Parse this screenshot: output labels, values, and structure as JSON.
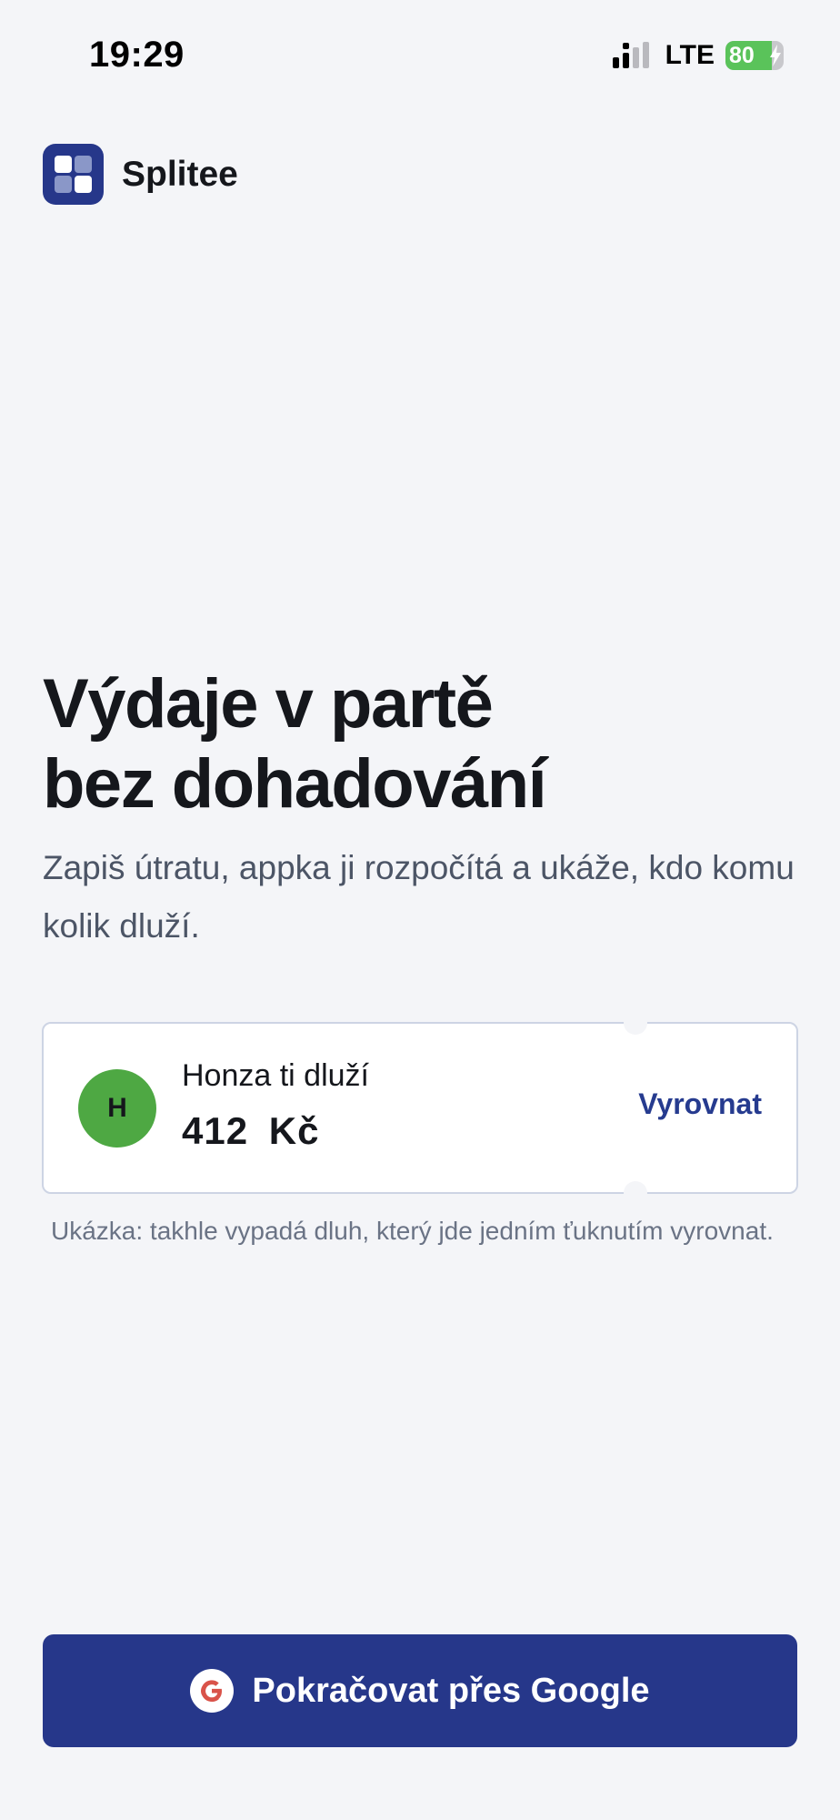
{
  "status_bar": {
    "time": "19:29",
    "network": "LTE",
    "battery": "80",
    "battery_level": 0.8
  },
  "brand": {
    "name": "Splitee",
    "logo_color": "#26378a"
  },
  "hero": {
    "title_line1": "Výdaje v partě",
    "title_line2": "bez dohadování",
    "subtitle": "Zapiš útratu, appka ji rozpočítá a ukáže, kdo komu kolik dluží."
  },
  "demo_card": {
    "avatar_initial": "H",
    "avatar_color": "#4ea843",
    "label": "Honza ti dluží",
    "amount": "412 Kč",
    "action_label": "Vyrovnat"
  },
  "demo_caption": "Ukázka: takhle vypadá dluh, který jde jedním ťuknutím vyrovnat.",
  "google_button": {
    "label": "Pokračovat přes Google",
    "background": "#26378a"
  }
}
